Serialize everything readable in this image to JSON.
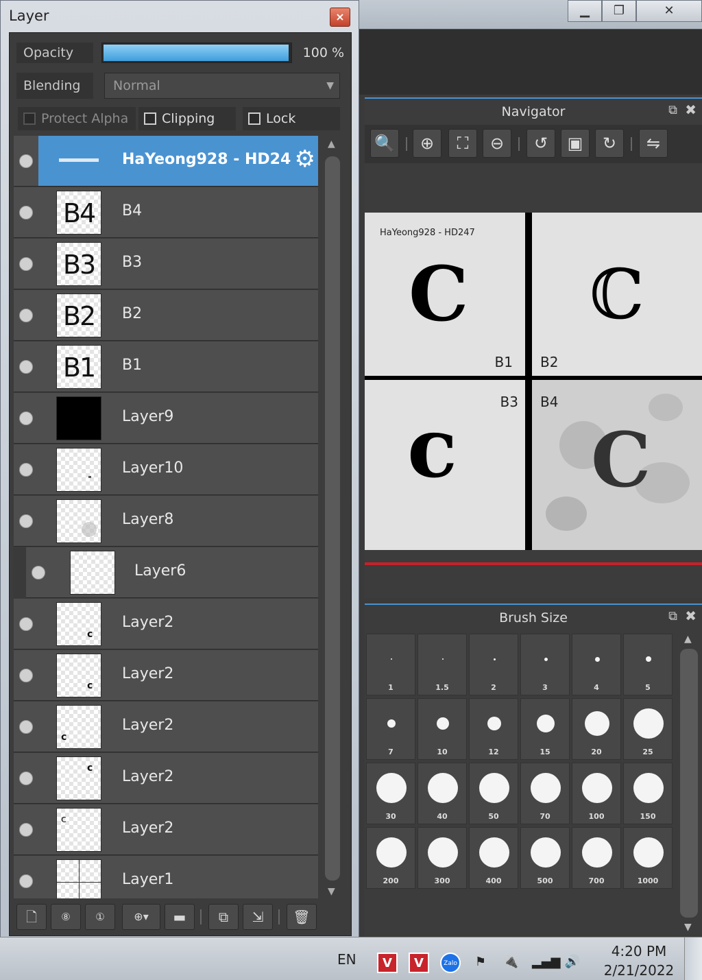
{
  "layer_panel": {
    "title": "Layer",
    "close_icon": "×",
    "opacity": {
      "label": "Opacity",
      "value": "100 %"
    },
    "blending": {
      "label": "Blending",
      "value": "Normal"
    },
    "checkboxes": {
      "protect_alpha": "Protect Alpha",
      "clipping": "Clipping",
      "lock": "Lock"
    },
    "layers": [
      {
        "name": "HaYeong928 - HD24",
        "selected": true
      },
      {
        "name": "B4",
        "thumb": "B4"
      },
      {
        "name": "B3",
        "thumb": "B3"
      },
      {
        "name": "B2",
        "thumb": "B2"
      },
      {
        "name": "B1",
        "thumb": "B1"
      },
      {
        "name": "Layer9"
      },
      {
        "name": "Layer10"
      },
      {
        "name": "Layer8"
      },
      {
        "name": "Layer6"
      },
      {
        "name": "Layer2"
      },
      {
        "name": "Layer2"
      },
      {
        "name": "Layer2"
      },
      {
        "name": "Layer2"
      },
      {
        "name": "Layer2"
      },
      {
        "name": "Layer1"
      }
    ],
    "toolbar_icons": [
      "new-layer-icon",
      "new-8bit-layer-icon",
      "new-1bit-layer-icon",
      "add-layer-menu-icon",
      "folder-icon",
      "duplicate-icon",
      "merge-down-icon",
      "delete-icon"
    ]
  },
  "navigator": {
    "title": "Navigator",
    "canvas_text": "HaYeong928 - HD247",
    "cells": [
      {
        "label": "B1",
        "letter": "C"
      },
      {
        "label": "B2",
        "letter": "ℂ"
      },
      {
        "label": "B3",
        "letter": "c"
      },
      {
        "label": "B4",
        "letter": "C"
      }
    ],
    "accent_red": "#c8202a"
  },
  "brush_size": {
    "title": "Brush Size",
    "sizes": [
      "1",
      "1.5",
      "2",
      "3",
      "4",
      "5",
      "7",
      "10",
      "12",
      "15",
      "20",
      "25",
      "30",
      "40",
      "50",
      "70",
      "100",
      "150",
      "200",
      "300",
      "400",
      "500",
      "700",
      "1000"
    ]
  },
  "taskbar": {
    "language": "EN",
    "tray": {
      "v1": "V",
      "v2": "V",
      "zalo": "Zalo"
    },
    "time": "4:20 PM",
    "date": "2/21/2022"
  },
  "colors": {
    "selection": "#4a93d1",
    "panel_bg": "#3c3c3c",
    "row_bg": "#4e4e4e"
  }
}
